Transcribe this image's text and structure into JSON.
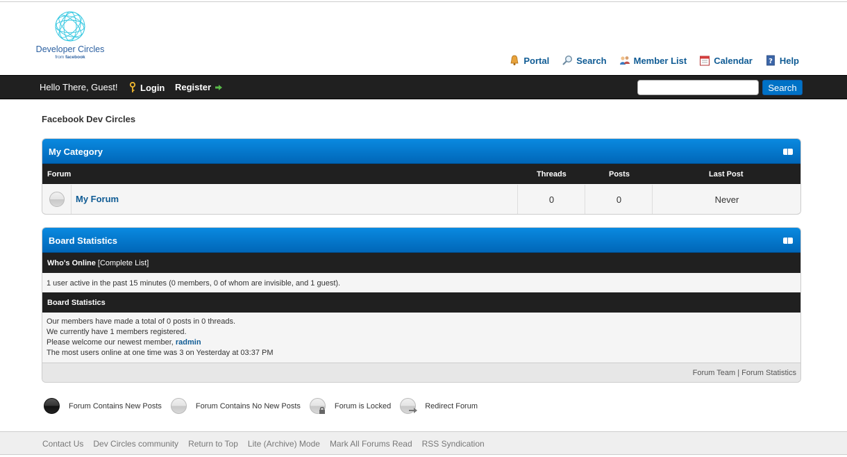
{
  "header": {
    "logo_name": "Developer Circles",
    "logo_sub_prefix": "from",
    "logo_sub_brand": "facebook",
    "nav": [
      {
        "label": "Portal",
        "icon": "bell-icon"
      },
      {
        "label": "Search",
        "icon": "magnifier-icon"
      },
      {
        "label": "Member List",
        "icon": "members-icon"
      },
      {
        "label": "Calendar",
        "icon": "calendar-icon"
      },
      {
        "label": "Help",
        "icon": "help-book-icon"
      }
    ]
  },
  "panel": {
    "greeting": "Hello There, Guest!",
    "login_label": "Login",
    "register_label": "Register",
    "search_value": "",
    "search_button": "Search"
  },
  "breadcrumb": "Facebook Dev Circles",
  "category": {
    "title": "My Category",
    "columns": {
      "forum": "Forum",
      "threads": "Threads",
      "posts": "Posts",
      "last_post": "Last Post"
    },
    "rows": [
      {
        "name": "My Forum",
        "threads": "0",
        "posts": "0",
        "last_post": "Never"
      }
    ]
  },
  "board_stats": {
    "title": "Board Statistics",
    "whos_online_label": "Who's Online",
    "complete_list": "[Complete List]",
    "online_text": "1 user active in the past 15 minutes (0 members, 0 of whom are invisible, and 1 guest).",
    "stats_header": "Board Statistics",
    "line1": "Our members have made a total of 0 posts in 0 threads.",
    "line2": "We currently have 1 members registered.",
    "line3_prefix": "Please welcome our newest member, ",
    "newest_member": "radmin",
    "line4": "The most users online at one time was 3 on Yesterday at 03:37 PM",
    "forum_team": "Forum Team",
    "separator": "|",
    "forum_statistics": "Forum Statistics"
  },
  "legend": [
    {
      "label": "Forum Contains New Posts"
    },
    {
      "label": "Forum Contains No New Posts"
    },
    {
      "label": "Forum is Locked"
    },
    {
      "label": "Redirect Forum"
    }
  ],
  "footer": {
    "links": [
      "Contact Us",
      "Dev Circles community",
      "Return to Top",
      "Lite (Archive) Mode",
      "Mark All Forums Read",
      "RSS Syndication"
    ]
  },
  "colors": {
    "accent_blue": "#0072c6",
    "link_blue": "#0f5b94",
    "dark_bar": "#202020"
  }
}
